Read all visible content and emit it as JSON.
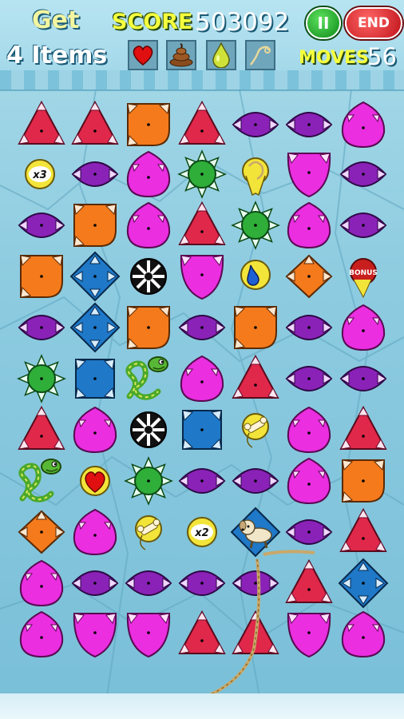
{
  "hud": {
    "goal_word": "Get",
    "goal_count": "4 Items",
    "score_label": "SCORE",
    "score_value": "503092",
    "pause_label": "II",
    "end_label": "END",
    "moves_label": "MOVES",
    "moves_value": "56",
    "goal_items": [
      "heart-icon",
      "poop-icon",
      "drop-icon",
      "rope-icon"
    ]
  },
  "colors": {
    "red": "#e0284a",
    "purple": "#8a22b8",
    "orange": "#f47a1c",
    "magenta": "#ea2ee0",
    "blue": "#1f78c8",
    "green": "#2fae3a"
  },
  "board": {
    "cols": 7,
    "rows": 11,
    "tiles": [
      [
        "red-tri",
        "red-tri",
        "orange-sq",
        "red-tri",
        "purple-leaf",
        "purple-leaf",
        "magenta-drop"
      ],
      [
        "x3-coin",
        "purple-leaf",
        "magenta-drop",
        "green-star",
        "yellow-bulb",
        "magenta-cup",
        "purple-leaf"
      ],
      [
        "purple-leaf",
        "orange-sq",
        "magenta-drop",
        "red-tri",
        "green-star",
        "magenta-drop",
        "purple-leaf"
      ],
      [
        "orange-sq",
        "blue-diamond",
        "black-wheel",
        "magenta-cup",
        "blue-drop",
        "orange-diamond",
        "bonus-badge"
      ],
      [
        "purple-leaf",
        "blue-diamond",
        "orange-sq",
        "purple-leaf",
        "orange-sq",
        "purple-leaf",
        "magenta-drop"
      ],
      [
        "green-star",
        "blue-square",
        "snake",
        "magenta-drop",
        "red-tri",
        "purple-leaf",
        "purple-leaf"
      ],
      [
        "red-tri",
        "magenta-drop",
        "black-wheel",
        "blue-square",
        "yellow-bone",
        "magenta-drop",
        "red-tri"
      ],
      [
        "snake",
        "heart-item",
        "green-star",
        "purple-leaf",
        "purple-leaf",
        "magenta-drop",
        "orange-sq"
      ],
      [
        "orange-diamond",
        "magenta-drop",
        "yellow-bone",
        "x2-coin",
        "dog",
        "purple-leaf",
        "red-tri"
      ],
      [
        "magenta-drop",
        "purple-leaf",
        "purple-leaf",
        "purple-leaf",
        "purple-leaf",
        "red-tri",
        "blue-diamond"
      ],
      [
        "magenta-drop",
        "magenta-cup",
        "magenta-cup",
        "red-tri",
        "red-tri",
        "magenta-cup",
        "magenta-drop"
      ]
    ],
    "coin_labels": {
      "x3-coin": "x3",
      "x2-coin": "x2",
      "bonus-badge": "BONUS"
    }
  }
}
